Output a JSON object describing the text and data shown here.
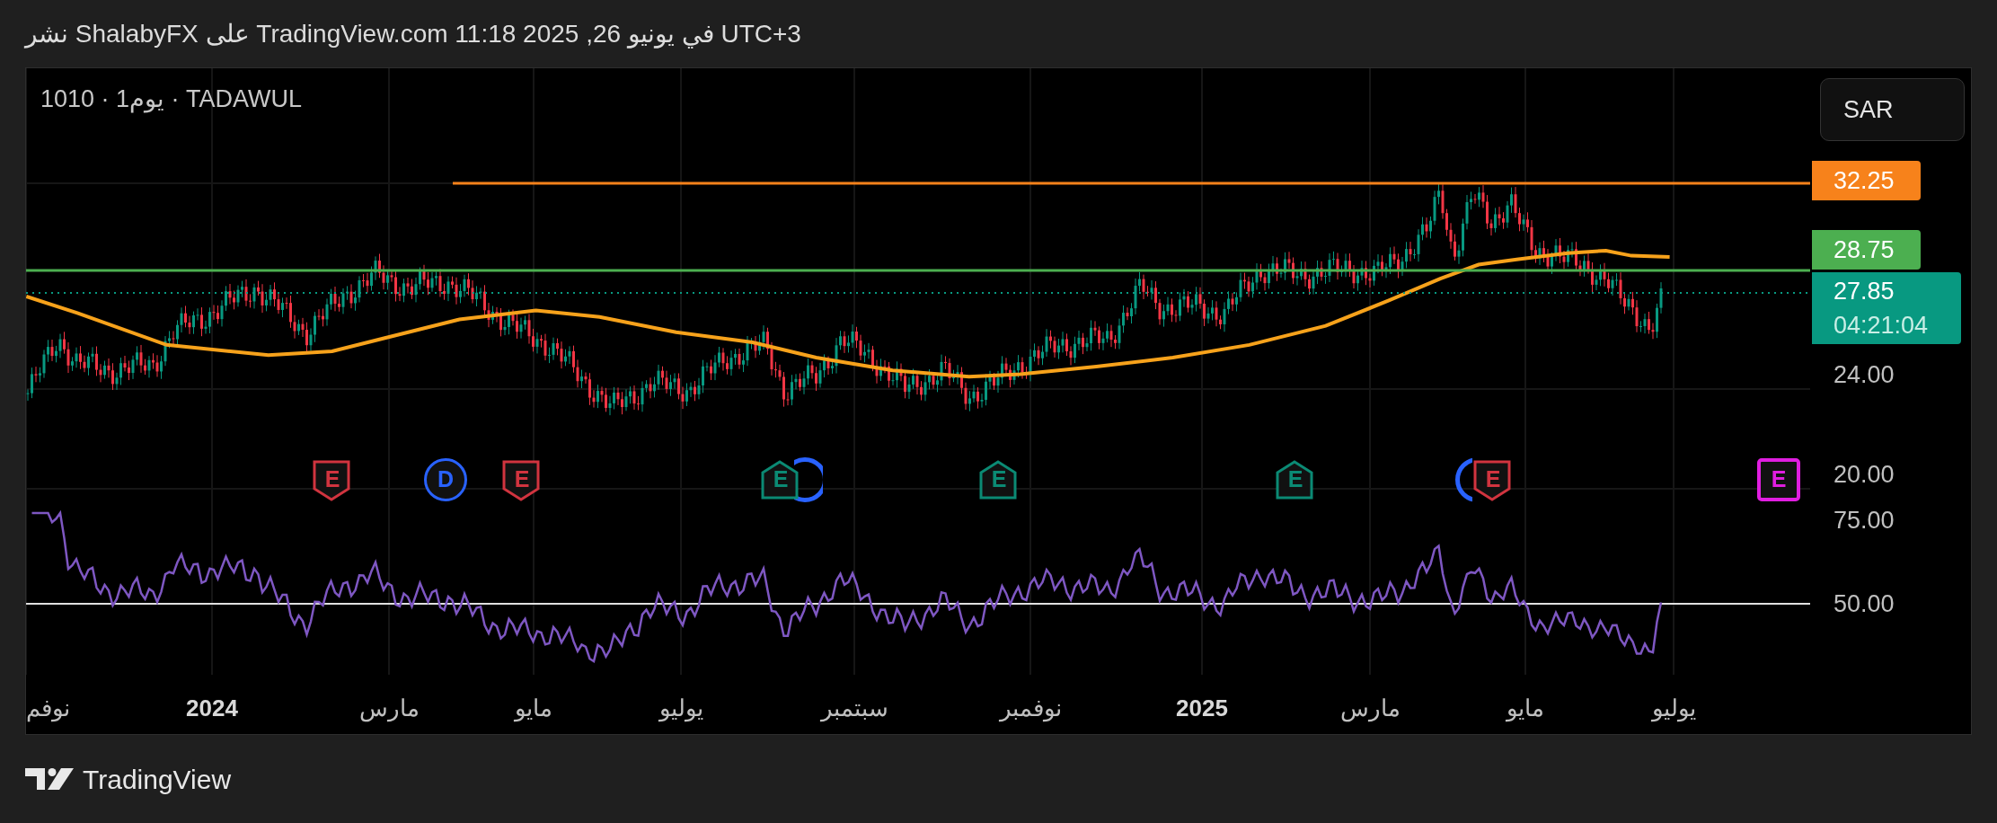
{
  "header": {
    "text": "نشر ShalabyFX على TradingView.com في يونيو 26, 2025 11:18 UTC+3"
  },
  "chart": {
    "symbol": "TADAWUL · يوم1 · 1010",
    "currency_button": "SAR",
    "price_labels": [
      {
        "kind": "level",
        "text": "32.25",
        "color": "#f7821b"
      },
      {
        "kind": "level",
        "text": "28.75",
        "color": "#4caf50"
      },
      {
        "kind": "last",
        "text": "27.85",
        "countdown": "04:21:04",
        "color": "#089981"
      },
      {
        "kind": "tick",
        "text": "24.00"
      },
      {
        "kind": "tick",
        "text": "20.00"
      }
    ],
    "events": [
      {
        "kind": "earnings-future",
        "letter": "E",
        "color": "#e01ee0"
      },
      {
        "kind": "earnings-down",
        "letter": "E",
        "color": "#d1343f"
      },
      {
        "kind": "dividend",
        "color": "#2962ff"
      },
      {
        "kind": "earnings-up",
        "letter": "E",
        "color": "#0b8a74"
      },
      {
        "kind": "earnings-up",
        "letter": "E",
        "color": "#0b8a74"
      },
      {
        "kind": "dividend",
        "color": "#2962ff"
      },
      {
        "kind": "earnings-up",
        "letter": "E",
        "color": "#0b8a74"
      },
      {
        "kind": "earnings-down",
        "letter": "E",
        "color": "#d1343f"
      },
      {
        "kind": "dividend",
        "letter": "D",
        "color": "#2962ff"
      },
      {
        "kind": "earnings-down",
        "letter": "E",
        "color": "#d1343f"
      }
    ],
    "rsi_labels": [
      "75.00",
      "50.00"
    ],
    "time_axis": [
      {
        "kind": "month",
        "text": "يوليو"
      },
      {
        "kind": "month",
        "text": "مايو"
      },
      {
        "kind": "month",
        "text": "مارس"
      },
      {
        "kind": "year",
        "text": "2025"
      },
      {
        "kind": "month",
        "text": "نوفمبر"
      },
      {
        "kind": "month",
        "text": "سبتمبر"
      },
      {
        "kind": "month",
        "text": "يوليو"
      },
      {
        "kind": "month",
        "text": "مايو"
      },
      {
        "kind": "month",
        "text": "مارس"
      },
      {
        "kind": "year",
        "text": "2024"
      },
      {
        "kind": "month",
        "text": "نوفم"
      }
    ]
  },
  "footer": {
    "brand": "TradingView"
  }
}
